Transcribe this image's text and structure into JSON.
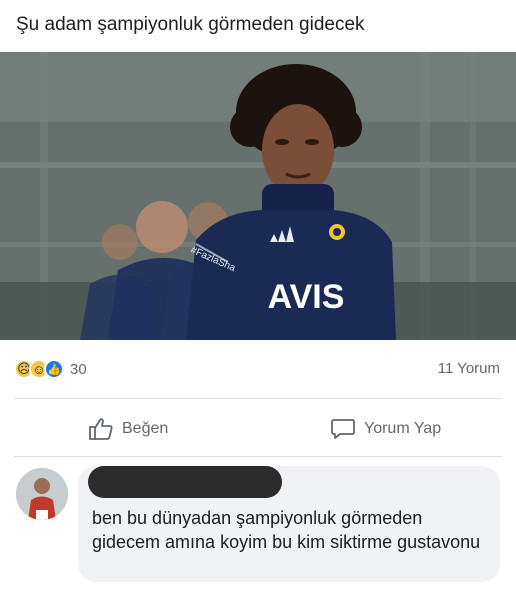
{
  "post": {
    "text": "Şu adam şampiyonluk görmeden gidecek",
    "jersey_sponsor": "AVIS",
    "jersey_sleeve": "#FazlaSha"
  },
  "reactions": {
    "icons": [
      "sad-icon",
      "haha-icon",
      "like-icon"
    ],
    "count": "30",
    "comment_count": "11 Yorum"
  },
  "actions": {
    "like_label": "Beğen",
    "comment_label": "Yorum Yap"
  },
  "comment": {
    "text": "ben bu dünyadan şampiyonluk görmeden gidecem amına koyim bu kim siktirme gustavonu"
  },
  "colors": {
    "text": "#1c1e21",
    "muted": "#65676b",
    "like_blue": "#1877f2",
    "bubble": "#f0f2f5",
    "jersey_navy": "#1b2a55"
  }
}
